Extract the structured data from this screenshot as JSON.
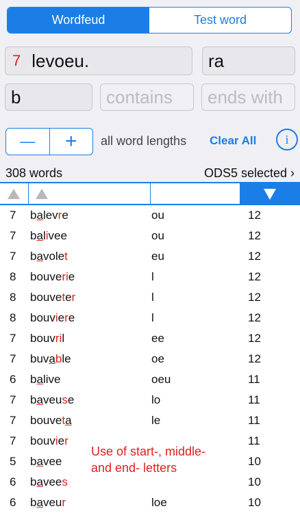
{
  "tabs": [
    {
      "label": "Wordfeud",
      "active": true
    },
    {
      "label": "Test word",
      "active": false
    }
  ],
  "search": {
    "count_prefix": "7",
    "letters": "levoeu.",
    "extra": "ra",
    "starts_with": "b",
    "contains_placeholder": "contains",
    "ends_with_placeholder": "ends with"
  },
  "controls": {
    "minus": "—",
    "plus": "+",
    "lengths_label": "all word lengths",
    "clear_label": "Clear All",
    "info": "i"
  },
  "summary": {
    "count_text": "308 words",
    "dict_text": "ODS5 selected ›"
  },
  "rows": [
    {
      "len": "7",
      "word": "balevre",
      "extra": "ou",
      "score": "12"
    },
    {
      "len": "7",
      "word": "balivee",
      "extra": "ou",
      "score": "12"
    },
    {
      "len": "7",
      "word": "bavolet",
      "extra": "eu",
      "score": "12"
    },
    {
      "len": "8",
      "word": "bouverie",
      "extra": "l",
      "score": "12"
    },
    {
      "len": "8",
      "word": "bouveter",
      "extra": "l",
      "score": "12"
    },
    {
      "len": "8",
      "word": "bouviere",
      "extra": "l",
      "score": "12"
    },
    {
      "len": "7",
      "word": "bouvril",
      "extra": "ee",
      "score": "12"
    },
    {
      "len": "7",
      "word": "buvable",
      "extra": "oe",
      "score": "12"
    },
    {
      "len": "6",
      "word": "balive",
      "extra": "oeu",
      "score": "11"
    },
    {
      "len": "7",
      "word": "baveuse",
      "extra": "lo",
      "score": "11"
    },
    {
      "len": "7",
      "word": "bouveta",
      "extra": "le",
      "score": "11"
    },
    {
      "len": "7",
      "word": "bouvier",
      "extra": "",
      "score": "11"
    },
    {
      "len": "5",
      "word": "bavee",
      "extra": "",
      "score": "10"
    },
    {
      "len": "6",
      "word": "bavees",
      "extra": "",
      "score": "10"
    },
    {
      "len": "6",
      "word": "baveur",
      "extra": "loe",
      "score": "10"
    }
  ],
  "overlay": {
    "line1": "Use of start-, middle-",
    "line2": "and end- letters"
  },
  "colors": {
    "accent": "#1a7ee6",
    "highlight": "#e0201a",
    "background": "#efeff4"
  }
}
